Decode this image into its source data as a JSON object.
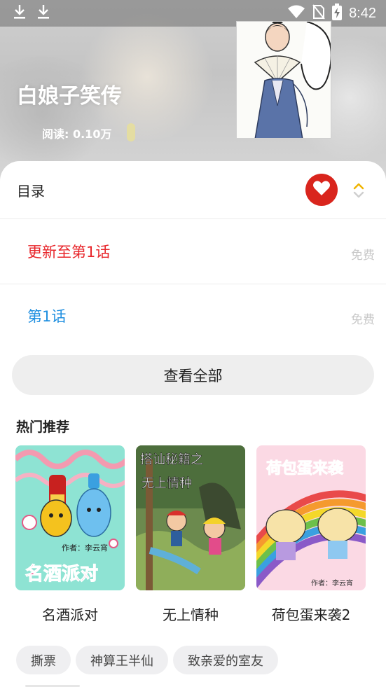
{
  "status_bar": {
    "time": "8:42",
    "icons": [
      "download-icon",
      "download-icon",
      "wifi-icon",
      "no-sim-icon",
      "battery-charging-icon"
    ]
  },
  "book": {
    "title": "白娘子笑传",
    "read_count": "阅读: 0.10万"
  },
  "toc": {
    "label": "目录",
    "favorite_icon": "heart-icon",
    "sort_icon": "sort-updown-icon",
    "accent": "#d9251d"
  },
  "chapters": [
    {
      "title": "更新至第1话",
      "price": "免费",
      "color": "#e8262b"
    },
    {
      "title": "第1话",
      "price": "免费",
      "color": "#1f8fe0"
    }
  ],
  "view_all_label": "查看全部",
  "recommend": {
    "title": "热门推荐",
    "items": [
      {
        "name": "名酒派对",
        "cover_text": "名酒派对",
        "cover_author": "作者：李云宵"
      },
      {
        "name": "无上情种",
        "cover_text": "搭讪秘籍之",
        "cover_subtext": "无上情种"
      },
      {
        "name": "荷包蛋来袭2",
        "cover_text": "荷包蛋来袭",
        "cover_author": "作者：李云宵"
      }
    ]
  },
  "tags": [
    "撕票",
    "神算王半仙",
    "致亲爱的室友"
  ]
}
